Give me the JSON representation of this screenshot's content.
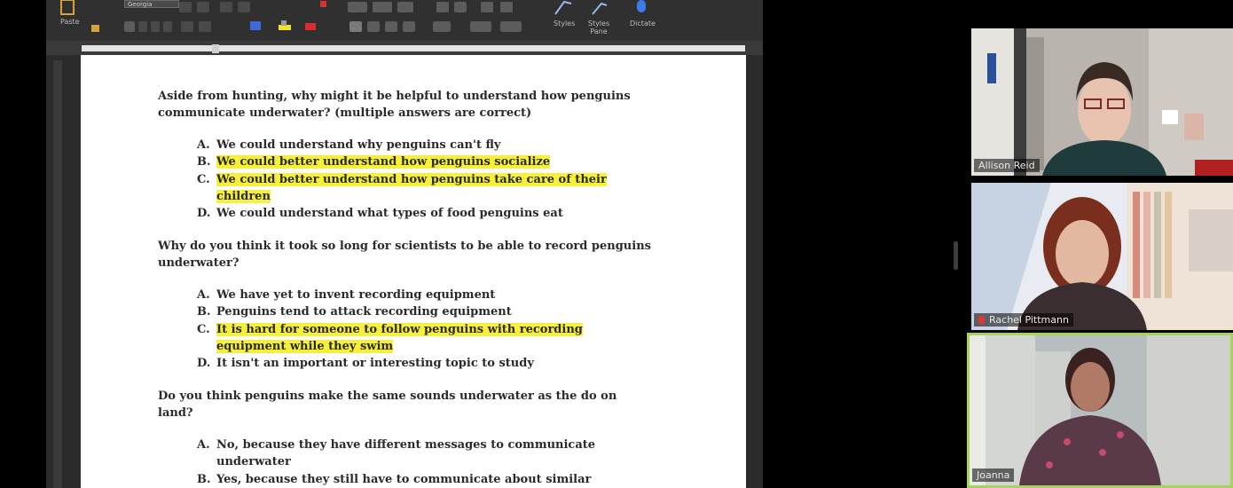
{
  "document": {
    "questions": [
      {
        "lines": [
          "Aside from hunting, why might it be helpful to understand how penguins",
          "communicate underwater? (multiple answers are correct)"
        ],
        "answers": [
          {
            "letter": "A.",
            "lines": [
              "We could understand why penguins can't fly"
            ],
            "highlighted": false
          },
          {
            "letter": "B.",
            "lines": [
              "We could better understand how penguins socialize"
            ],
            "highlighted": true
          },
          {
            "letter": "C.",
            "lines": [
              "We could better understand how penguins take care of their",
              "children"
            ],
            "highlighted": true
          },
          {
            "letter": "D.",
            "lines": [
              "We could understand what types of food penguins eat"
            ],
            "highlighted": false
          }
        ]
      },
      {
        "lines": [
          "Why do you think it took so long for scientists to be able to record penguins",
          "underwater?"
        ],
        "answers": [
          {
            "letter": "A.",
            "lines": [
              "We have yet to invent recording equipment"
            ],
            "highlighted": false
          },
          {
            "letter": "B.",
            "lines": [
              "Penguins tend to attack recording equipment"
            ],
            "highlighted": false
          },
          {
            "letter": "C.",
            "lines": [
              "It is hard for someone to follow penguins with recording",
              "equipment while they swim"
            ],
            "highlighted": true
          },
          {
            "letter": "D.",
            "lines": [
              "It isn't an important or interesting topic to study"
            ],
            "highlighted": false
          }
        ]
      },
      {
        "lines": [
          "Do you think penguins make the same sounds underwater as the do on",
          "land?"
        ],
        "answers": [
          {
            "letter": "A.",
            "lines": [
              "No, because they have different messages to communicate",
              "underwater"
            ],
            "highlighted": false
          },
          {
            "letter": "B.",
            "lines": [
              "Yes, because they still have to communicate about similar things"
            ],
            "highlighted": false
          }
        ]
      }
    ]
  },
  "ribbon": {
    "font_name": "Georgia",
    "labels": [
      "Paste",
      "Styles",
      "Styles Pane",
      "Dictate"
    ]
  },
  "participants": [
    {
      "name": "Allison Reid",
      "muted": false,
      "active_speaker": false
    },
    {
      "name": "Rachel Pittmann",
      "muted": true,
      "active_speaker": false
    },
    {
      "name": "Joanna",
      "muted": false,
      "active_speaker": true
    }
  ],
  "colors": {
    "highlight": "#f7f03b",
    "active_speaker_border": "#a5d45a",
    "mute_red": "#d83a3a"
  }
}
